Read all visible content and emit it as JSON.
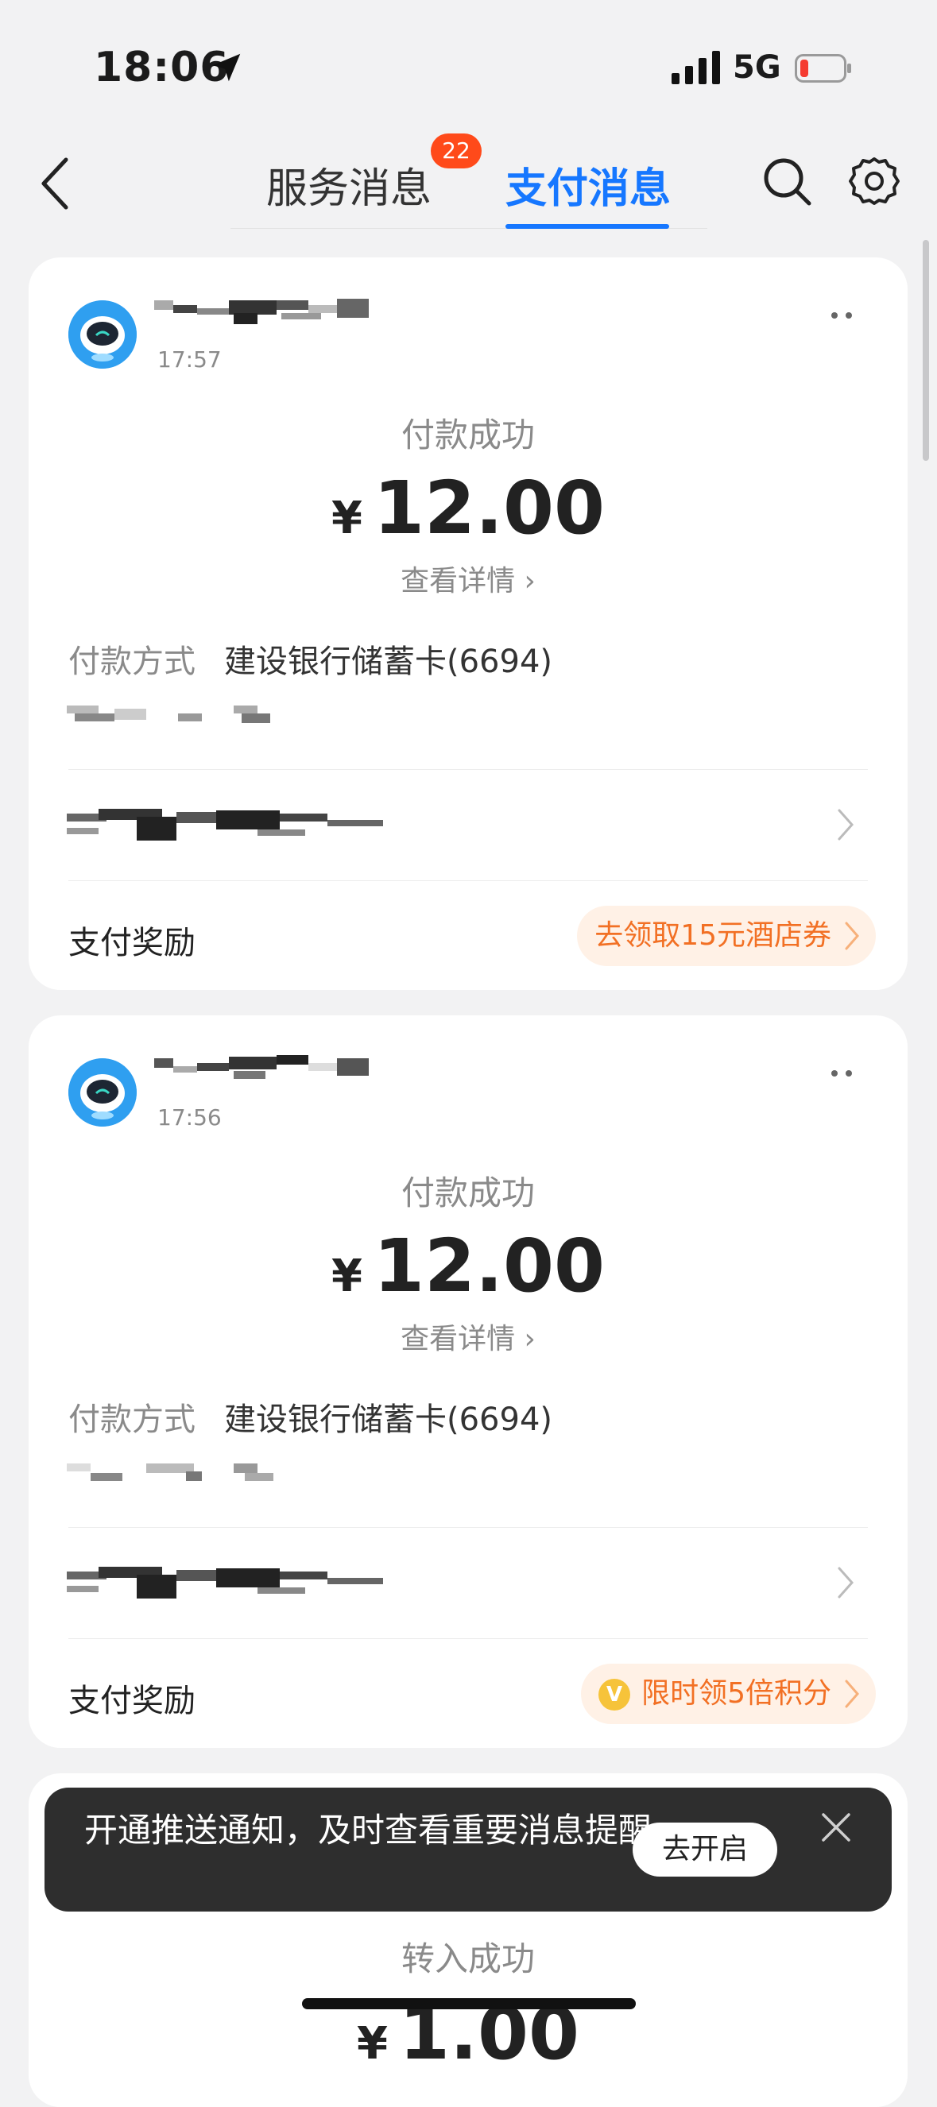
{
  "status_bar": {
    "time": "18:06",
    "network": "5G"
  },
  "nav": {
    "tabs": [
      {
        "label": "服务消息",
        "badge": "22"
      },
      {
        "label": "支付消息"
      }
    ]
  },
  "cards": [
    {
      "time": "17:57",
      "status": "付款成功",
      "currency": "¥",
      "amount": "12.00",
      "detail_link": "查看详情",
      "payment_method_label": "付款方式",
      "payment_method_value": "建设银行储蓄卡(6694)",
      "reward_label": "支付奖励",
      "reward_button": "去领取15元酒店券"
    },
    {
      "time": "17:56",
      "status": "付款成功",
      "currency": "¥",
      "amount": "12.00",
      "detail_link": "查看详情",
      "payment_method_label": "付款方式",
      "payment_method_value": "建设银行储蓄卡(6694)",
      "reward_label": "支付奖励",
      "reward_button": "限时领5倍积分",
      "reward_coin": "V"
    },
    {
      "status": "转入成功",
      "amount": "1.00"
    }
  ],
  "toast": {
    "text": "开通推送通知，及时查看重要消息提醒",
    "button": "去开启"
  },
  "colors": {
    "accent": "#1677ff",
    "badge": "#ff4a1a",
    "reward_text": "#f27024"
  }
}
